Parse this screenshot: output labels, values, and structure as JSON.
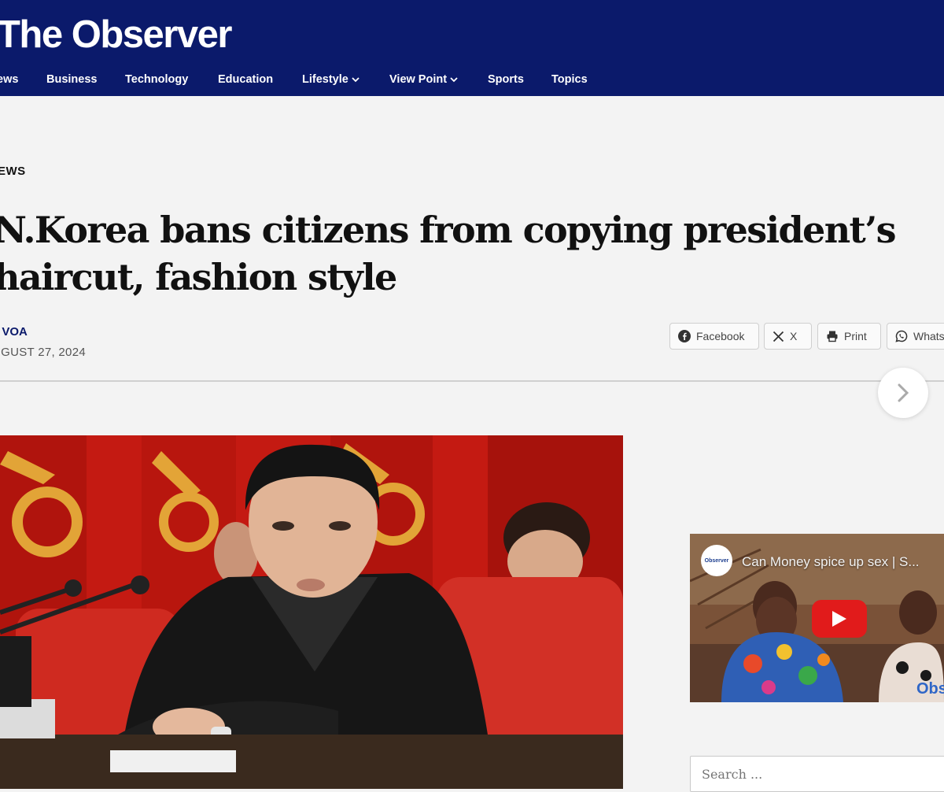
{
  "site": {
    "name": "The Observer"
  },
  "nav": {
    "items": [
      {
        "label": "ews",
        "has_dropdown": false
      },
      {
        "label": "Business",
        "has_dropdown": false
      },
      {
        "label": "Technology",
        "has_dropdown": false
      },
      {
        "label": "Education",
        "has_dropdown": false
      },
      {
        "label": "Lifestyle",
        "has_dropdown": true
      },
      {
        "label": "View Point",
        "has_dropdown": true
      },
      {
        "label": "Sports",
        "has_dropdown": false
      },
      {
        "label": "Topics",
        "has_dropdown": false
      }
    ]
  },
  "article": {
    "category": "EWS",
    "title_line1": "N.Korea bans citizens from copying president’s",
    "title_line2": "haircut, fashion style",
    "byline_prefix": "/",
    "author": "VOA",
    "date": "UGUST 27, 2024"
  },
  "share": {
    "facebook": "Facebook",
    "x": "X",
    "print": "Print",
    "whatsapp": "Whats"
  },
  "video": {
    "title": "Can Money spice up sex | S...",
    "channel_badge": "Observer",
    "watermark": "Obs"
  },
  "search": {
    "placeholder": "Search ..."
  },
  "colors": {
    "header_bg": "#0b1a6b",
    "page_bg": "#f3f3f3",
    "link": "#0b1a6b",
    "play_button": "#e11b1b"
  }
}
